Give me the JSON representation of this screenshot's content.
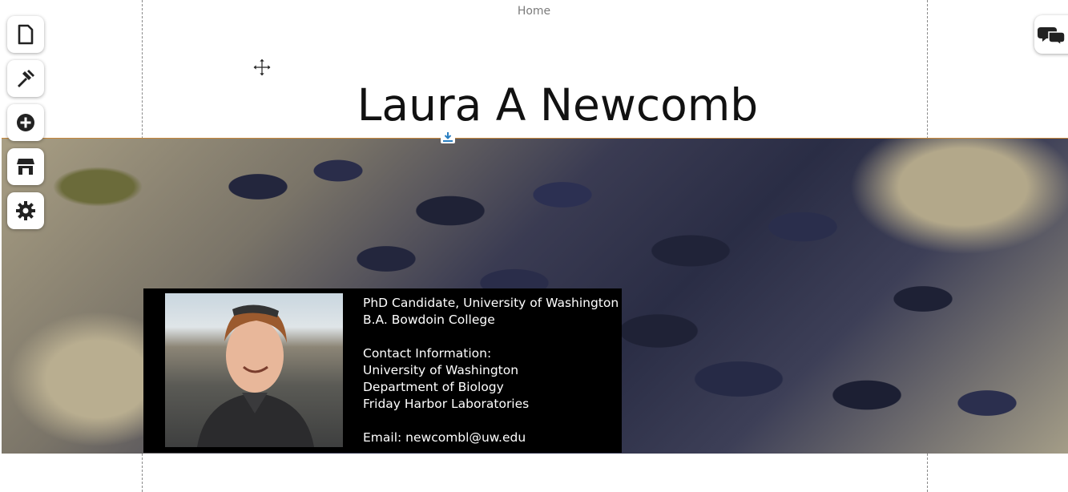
{
  "nav": {
    "home_label": "Home"
  },
  "site": {
    "title": "Laura A Newcomb"
  },
  "toolbar": {
    "buttons": [
      {
        "name": "pages-button",
        "icon": "page-icon"
      },
      {
        "name": "design-button",
        "icon": "hammer-icon"
      },
      {
        "name": "add-button",
        "icon": "plus-circle-icon"
      },
      {
        "name": "store-button",
        "icon": "store-icon"
      },
      {
        "name": "settings-button",
        "icon": "gear-icon"
      }
    ]
  },
  "chat": {
    "icon": "chat-bubbles-icon"
  },
  "hero": {
    "image": "mussels-and-barnacles-photo"
  },
  "profile": {
    "photo": "portrait-photo",
    "lines": {
      "degree1": "PhD Candidate, University of Washington",
      "degree2": "B.A. Bowdoin College",
      "contact_heading": "Contact Information:",
      "address1": "University of Washington",
      "address2": "Department of Biology",
      "address3": "Friday Harbor Laboratories",
      "email": "Email: newcombl@uw.edu"
    }
  },
  "colors": {
    "accent_line": "#c8873a",
    "info_box": "#000000",
    "text_on_dark": "#ffffff"
  }
}
